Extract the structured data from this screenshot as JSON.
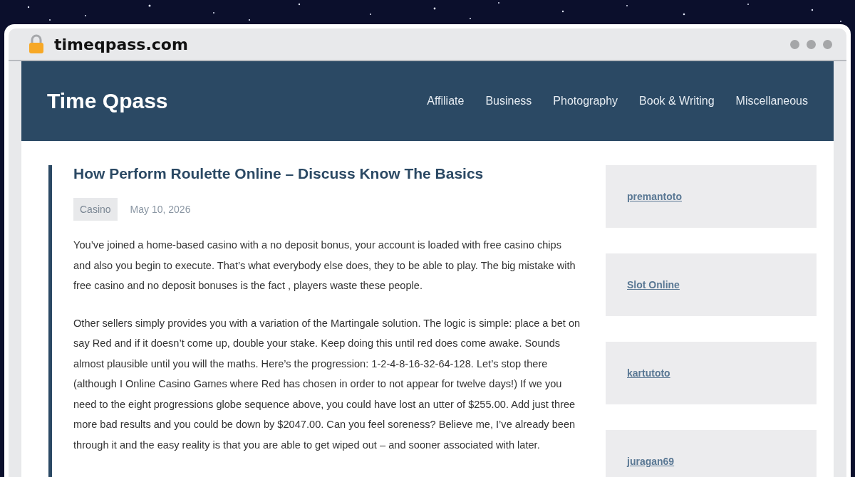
{
  "browser": {
    "address": "timeqpass.com"
  },
  "site": {
    "title": "Time Qpass",
    "nav": [
      {
        "label": "Affiliate"
      },
      {
        "label": "Business"
      },
      {
        "label": "Photography"
      },
      {
        "label": "Book & Writing"
      },
      {
        "label": "Miscellaneous"
      }
    ]
  },
  "article": {
    "title": "How Perform Roulette Online – Discuss Know The Basics",
    "category": "Casino",
    "date": "May 10, 2026",
    "paragraphs": [
      "You’ve joined a home-based casino with a no deposit bonus, your account is loaded with free casino chips and also you begin to execute. That’s what everybody else does, they to be able to play. The big mistake with free casino and no deposit bonuses is the fact , players waste these people.",
      "Other sellers simply provides you with a variation of the Martingale solution. The logic is simple: place a bet on say Red and if it doesn’t come up, double your stake. Keep doing this until red does come awake. Sounds almost plausible until you will the maths. Here’s the progression: 1-2-4-8-16-32-64-128. Let’s stop there (although I Online Casino Games where Red has chosen in order to not appear for twelve days!) If we you need to the eight progressions globe sequence above, you could have lost an utter of $255.00. Add just three more bad results and you could be down by $2047.00. Can you feel soreness? Believe me, I’ve already been through it and the easy reality is that you are able to get wiped out – and sooner associated with later."
    ]
  },
  "sidebar": {
    "links": [
      {
        "label": "premantoto"
      },
      {
        "label": "Slot Online"
      },
      {
        "label": "kartutoto"
      },
      {
        "label": "juragan69"
      }
    ]
  }
}
